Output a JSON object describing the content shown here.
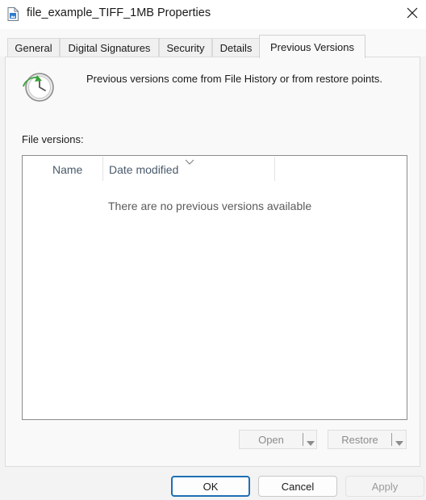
{
  "window": {
    "title": "file_example_TIFF_1MB Properties",
    "icons": {
      "file": "tiff-file-icon",
      "close": "close-icon"
    }
  },
  "tabs": [
    {
      "label": "General",
      "active": false
    },
    {
      "label": "Digital Signatures",
      "active": false
    },
    {
      "label": "Security",
      "active": false
    },
    {
      "label": "Details",
      "active": false
    },
    {
      "label": "Previous Versions",
      "active": true
    }
  ],
  "panel": {
    "icon": "history-clock-icon",
    "info_text": "Previous versions come from File History or from restore points.",
    "versions_label": "File versions:",
    "list": {
      "columns": [
        "Name",
        "Date modified"
      ],
      "sorted_column": "Date modified",
      "empty_message": "There are no previous versions available"
    },
    "open_button": {
      "label": "Open",
      "enabled": false
    },
    "restore_button": {
      "label": "Restore",
      "enabled": false
    }
  },
  "footer": {
    "ok_label": "OK",
    "cancel_label": "Cancel",
    "apply_label": "Apply",
    "apply_enabled": false
  },
  "colors": {
    "accent": "#1f6fb5",
    "clock_arrow": "#3aa43a",
    "disabled_text": "#8c8c8c"
  }
}
